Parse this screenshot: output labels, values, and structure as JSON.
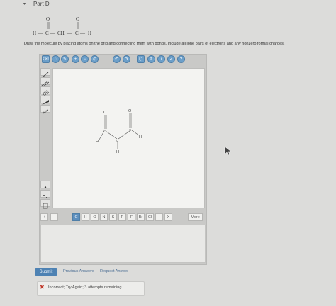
{
  "part": {
    "caret": "▾",
    "label": "Part D"
  },
  "formula": {
    "o1": "O",
    "o2": "O",
    "h_left": "H",
    "dash1": "—",
    "c1": "C",
    "dash2": "—",
    "ch": "CH",
    "dash3": "—",
    "c2": "C",
    "dash4": "—",
    "h_right": "H"
  },
  "instructions": "Draw the molecule by placing atoms on the grid and connecting them with bonds. Include all lone pairs of electrons and any nonzero formal charges.",
  "molecule": {
    "o_left": "O",
    "o_right": "O",
    "c_left": "C",
    "c_mid": "C",
    "c_right": "C",
    "h_left": "H",
    "h_mid": "H",
    "h_right": "H"
  },
  "atoms": [
    "C",
    "H",
    "O",
    "N",
    "S",
    "P",
    "F",
    "Br",
    "Cl",
    "I",
    "X"
  ],
  "more_label": "More",
  "submit_label": "Submit",
  "previous_answers_label": "Previous Answers",
  "request_answer_label": "Request Answer",
  "feedback": {
    "icon": "✖",
    "text": "Incorrect; Try Again; 3 attempts remaining"
  },
  "toolbar_icons": [
    "eraser-icon",
    "lasso-icon",
    "pencil-icon",
    "zoom-in-icon",
    "zoom-out-icon",
    "undo-icon",
    "redo-icon",
    "template-icon",
    "arrows-icon",
    "info-icon",
    "check-icon",
    "help-icon"
  ],
  "colors": {
    "accent": "#4e82b3",
    "error": "#c0392b"
  }
}
